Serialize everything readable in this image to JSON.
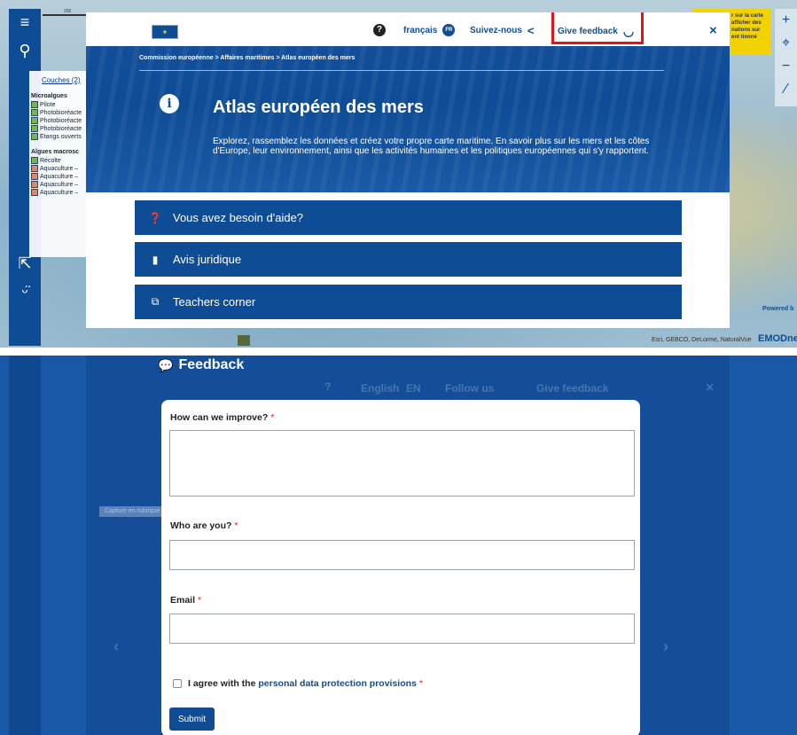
{
  "top": {
    "modal": {
      "help_icon": "question-circle-icon",
      "language": "français",
      "language_code": "FR",
      "follow": "Suivez-nous",
      "feedback": "Give feedback",
      "close": "×",
      "breadcrumb": "Commission européenne > Affaires maritimes > Atlas européen des mers",
      "title": "Atlas européen des mers",
      "description": "Explorez, rassemblez les données et créez votre propre carte maritime. En savoir plus sur les mers et les côtes d'Europe, leur environnement, ainsi que les activités humaines et les politiques européennes qui s'y rapportent.",
      "accordion": [
        {
          "icon": "question-circle-icon",
          "label": "Vous avez besoin d'aide?"
        },
        {
          "icon": "speech-bubble-icon",
          "label": "Avis juridique"
        },
        {
          "icon": "teacher-icon",
          "label": "Teachers corner"
        }
      ]
    },
    "layers": {
      "heading": "Couches (2)",
      "group1": "Microalgues",
      "group1_items": [
        "Pilote",
        "Photobioréacte",
        "Photobioréacte",
        "Photobioréacte",
        "Étangs ouverts"
      ],
      "group2": "Algues macrosc",
      "group2_items": [
        "Récolte",
        "Aquaculture –",
        "Aquaculture –",
        "Aquaculture –",
        "Aquaculture –"
      ]
    },
    "yellow_note": "r sur la carte afficher des nations sur ent tionné",
    "attribution": "Esri, GEBCO, DeLorme, NaturalVue",
    "emod": "EMODne",
    "powered": "Powered b",
    "scale_label": "200"
  },
  "bottom": {
    "ghost": {
      "language": "English",
      "language_code": "EN",
      "follow": "Follow us",
      "feedback": "Give feedback",
      "close": "×",
      "overlay_tag": "Capture en rubrique"
    },
    "feedback_title": "Feedback",
    "q1_label": "How can we improve?",
    "q2_label": "Who are you?",
    "q3_label": "Email",
    "required_mark": "*",
    "agree_text": "I agree with the",
    "agree_link": "personal data protection provisions",
    "submit": "Submit"
  },
  "colors": {
    "brand_blue": "#0f4c96",
    "highlight_red": "#e51318",
    "required_red": "#d61b22"
  }
}
